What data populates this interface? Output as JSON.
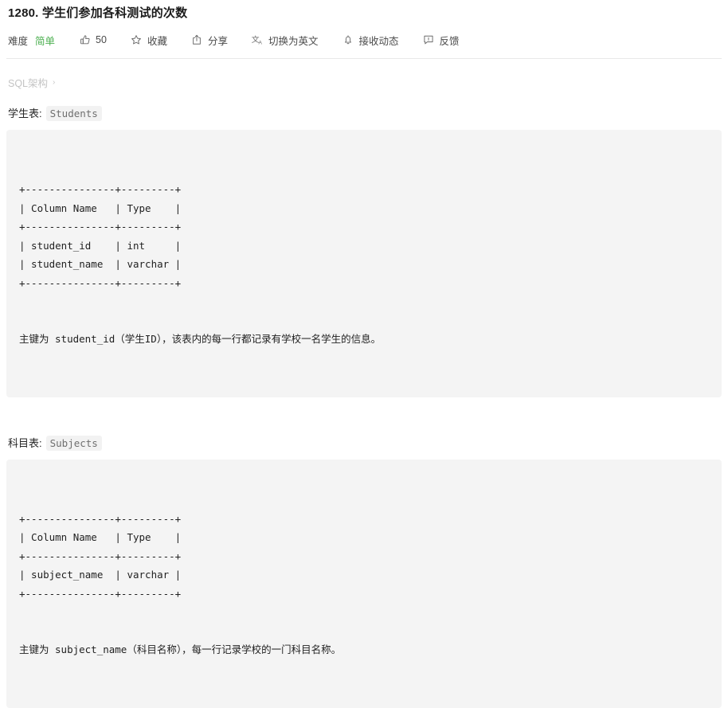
{
  "header": {
    "title": "1280. 学生们参加各科测试的次数"
  },
  "toolbar": {
    "difficulty_label": "难度",
    "difficulty_value": "简单",
    "difficulty_color": "#4caf50",
    "like_count": "50",
    "like_icon": "thumbs-up-icon",
    "favorite_label": "收藏",
    "favorite_icon": "star-icon",
    "share_label": "分享",
    "share_icon": "share-icon",
    "translate_label": "切换为英文",
    "translate_icon": "translate-icon",
    "subscribe_label": "接收动态",
    "subscribe_icon": "bell-icon",
    "feedback_label": "反馈",
    "feedback_icon": "feedback-icon"
  },
  "breadcrumb": {
    "root": "SQL架构",
    "separator": "›"
  },
  "sections": [
    {
      "heading_label": "学生表:",
      "heading_code": "Students",
      "ascii_table": "+---------------+---------+\n| Column Name   | Type    |\n+---------------+---------+\n| student_id    | int     |\n| student_name  | varchar |\n+---------------+---------+",
      "caption": "主键为 student_id（学生ID），该表内的每一行都记录有学校一名学生的信息。"
    },
    {
      "heading_label": "科目表:",
      "heading_code": "Subjects",
      "ascii_table": "+---------------+---------+\n| Column Name   | Type    |\n+---------------+---------+\n| subject_name  | varchar |\n+---------------+---------+",
      "caption": "主键为 subject_name（科目名称），每一行记录学校的一门科目名称。"
    }
  ],
  "schema_tables": [
    {
      "name": "Students",
      "columns": [
        {
          "column_name": "student_id",
          "type": "int"
        },
        {
          "column_name": "student_name",
          "type": "varchar"
        }
      ],
      "primary_key": "student_id"
    },
    {
      "name": "Subjects",
      "columns": [
        {
          "column_name": "subject_name",
          "type": "varchar"
        }
      ],
      "primary_key": "subject_name"
    }
  ],
  "colors": {
    "accent_green": "#4caf50",
    "code_bg": "#f4f4f4",
    "chip_bg": "#f2f2f2",
    "divider": "#e8e8e8",
    "muted_text": "#c4c4c4"
  }
}
